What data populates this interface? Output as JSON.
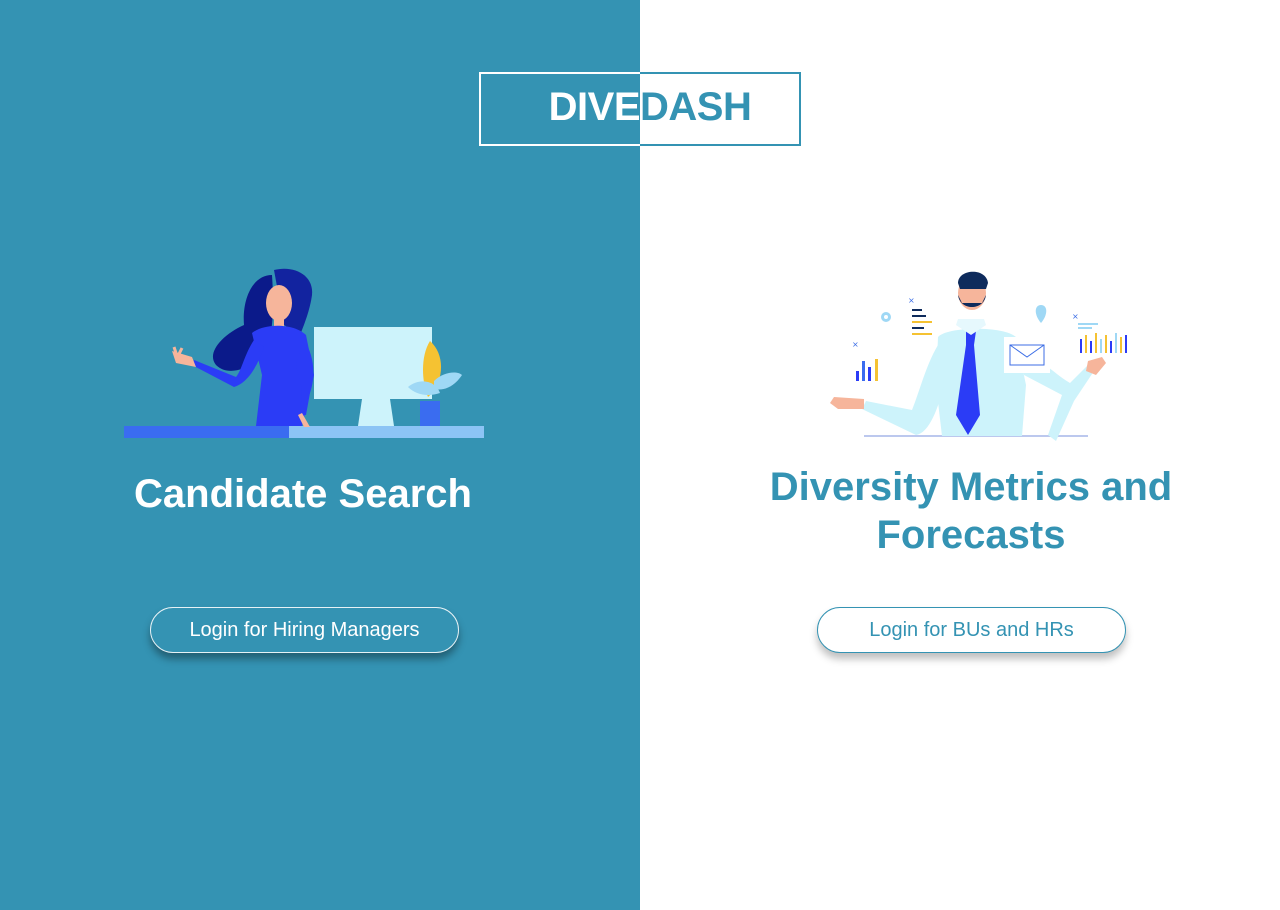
{
  "logo": {
    "part1": "DIVE",
    "part2": "DASH"
  },
  "left": {
    "title": "Candidate Search",
    "login_label": "Login for Hiring Managers"
  },
  "right": {
    "title": "Diversity Metrics and Forecasts",
    "login_label": "Login for BUs and HRs"
  },
  "colors": {
    "brand_teal": "#3493b3",
    "white": "#ffffff",
    "illustration_blue": "#2f3ef5",
    "illustration_light": "#c9f1fb",
    "accent_yellow": "#f5c232"
  },
  "icons": {
    "left_illustration": "woman-at-computer-illustration",
    "right_illustration": "businessman-with-charts-illustration"
  }
}
